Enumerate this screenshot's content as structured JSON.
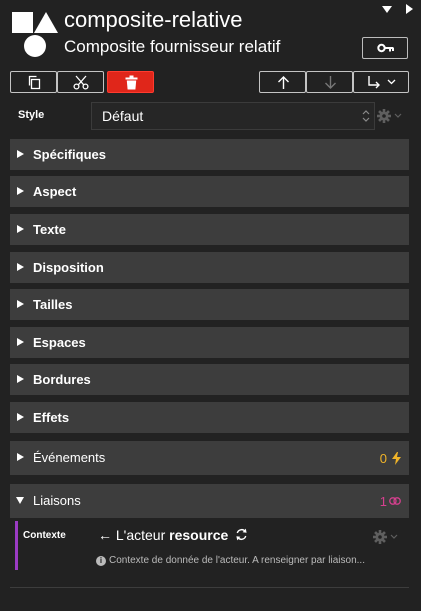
{
  "header": {
    "title": "composite-relative",
    "subtitle": "Composite fournisseur relatif"
  },
  "style": {
    "label": "Style",
    "value": "Défaut"
  },
  "sections": [
    {
      "label": "Spécifiques"
    },
    {
      "label": "Aspect"
    },
    {
      "label": "Texte"
    },
    {
      "label": "Disposition"
    },
    {
      "label": "Tailles"
    },
    {
      "label": "Espaces"
    },
    {
      "label": "Bordures"
    },
    {
      "label": "Effets"
    },
    {
      "label": "Événements",
      "count": "0",
      "count_color": "#f0b429"
    },
    {
      "label": "Liaisons",
      "count": "1",
      "count_color": "#d6408f",
      "expanded": true
    }
  ],
  "contexte": {
    "label": "Contexte",
    "value_prefix": "L'acteur",
    "value_bold": "resource",
    "help": "Contexte de donnée de l'acteur. A renseigner par liaison..."
  },
  "colors": {
    "background": "#222222",
    "section_bg": "#3d3d3d",
    "delete_button": "#e0261a",
    "bind_accent": "#9b3bc4"
  }
}
